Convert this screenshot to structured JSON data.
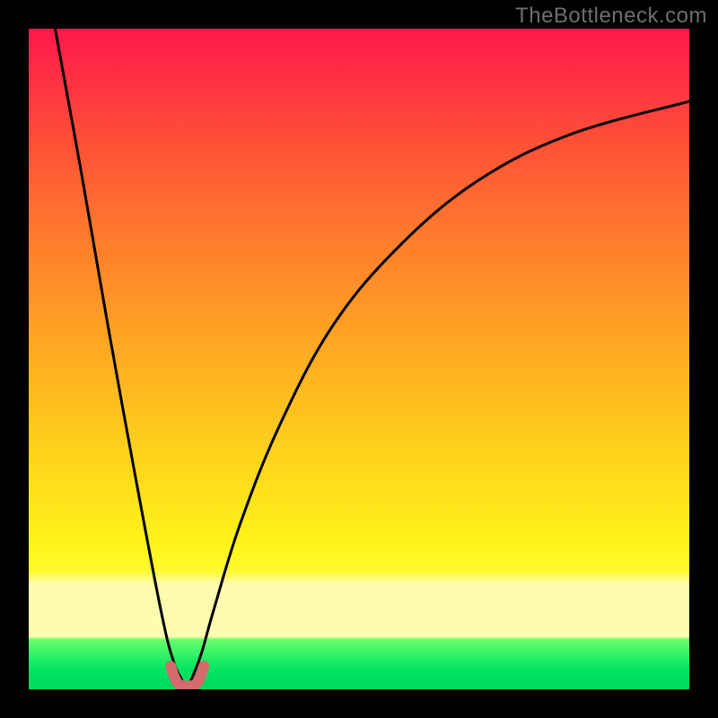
{
  "watermark": "TheBottleneck.com",
  "chart_data": {
    "type": "line",
    "title": "",
    "xlabel": "",
    "ylabel": "",
    "xlim": [
      0,
      100
    ],
    "ylim": [
      0,
      100
    ],
    "grid": false,
    "legend": false,
    "annotations": [],
    "notes": "Bottleneck curve: two branches descending to a common minimum near x≈24 where y≈0. Background is a vertical red→yellow→green gradient (green at bottom = no bottleneck). Values are estimated from pixel positions; axes are unlabeled in the source image.",
    "series": [
      {
        "name": "left-branch",
        "x": [
          4,
          8,
          12,
          16,
          20,
          22,
          24
        ],
        "values": [
          100,
          78,
          55,
          33,
          12,
          4,
          0
        ]
      },
      {
        "name": "right-branch",
        "x": [
          24,
          26,
          28,
          32,
          38,
          46,
          56,
          68,
          82,
          100
        ],
        "values": [
          0,
          5,
          12,
          25,
          40,
          55,
          67,
          77,
          84,
          89
        ]
      },
      {
        "name": "optimal-region-marker",
        "x": [
          21.5,
          22.5,
          24,
          25.5,
          26.5
        ],
        "values": [
          3.5,
          1,
          0.5,
          1,
          3.5
        ]
      }
    ],
    "gradient_stops": [
      {
        "pos": 0,
        "color": "#ff184b"
      },
      {
        "pos": 0.45,
        "color": "#ffa024"
      },
      {
        "pos": 0.78,
        "color": "#fff31a"
      },
      {
        "pos": 0.88,
        "color": "#fffcb0"
      },
      {
        "pos": 1.0,
        "color": "#00d85c"
      }
    ]
  }
}
